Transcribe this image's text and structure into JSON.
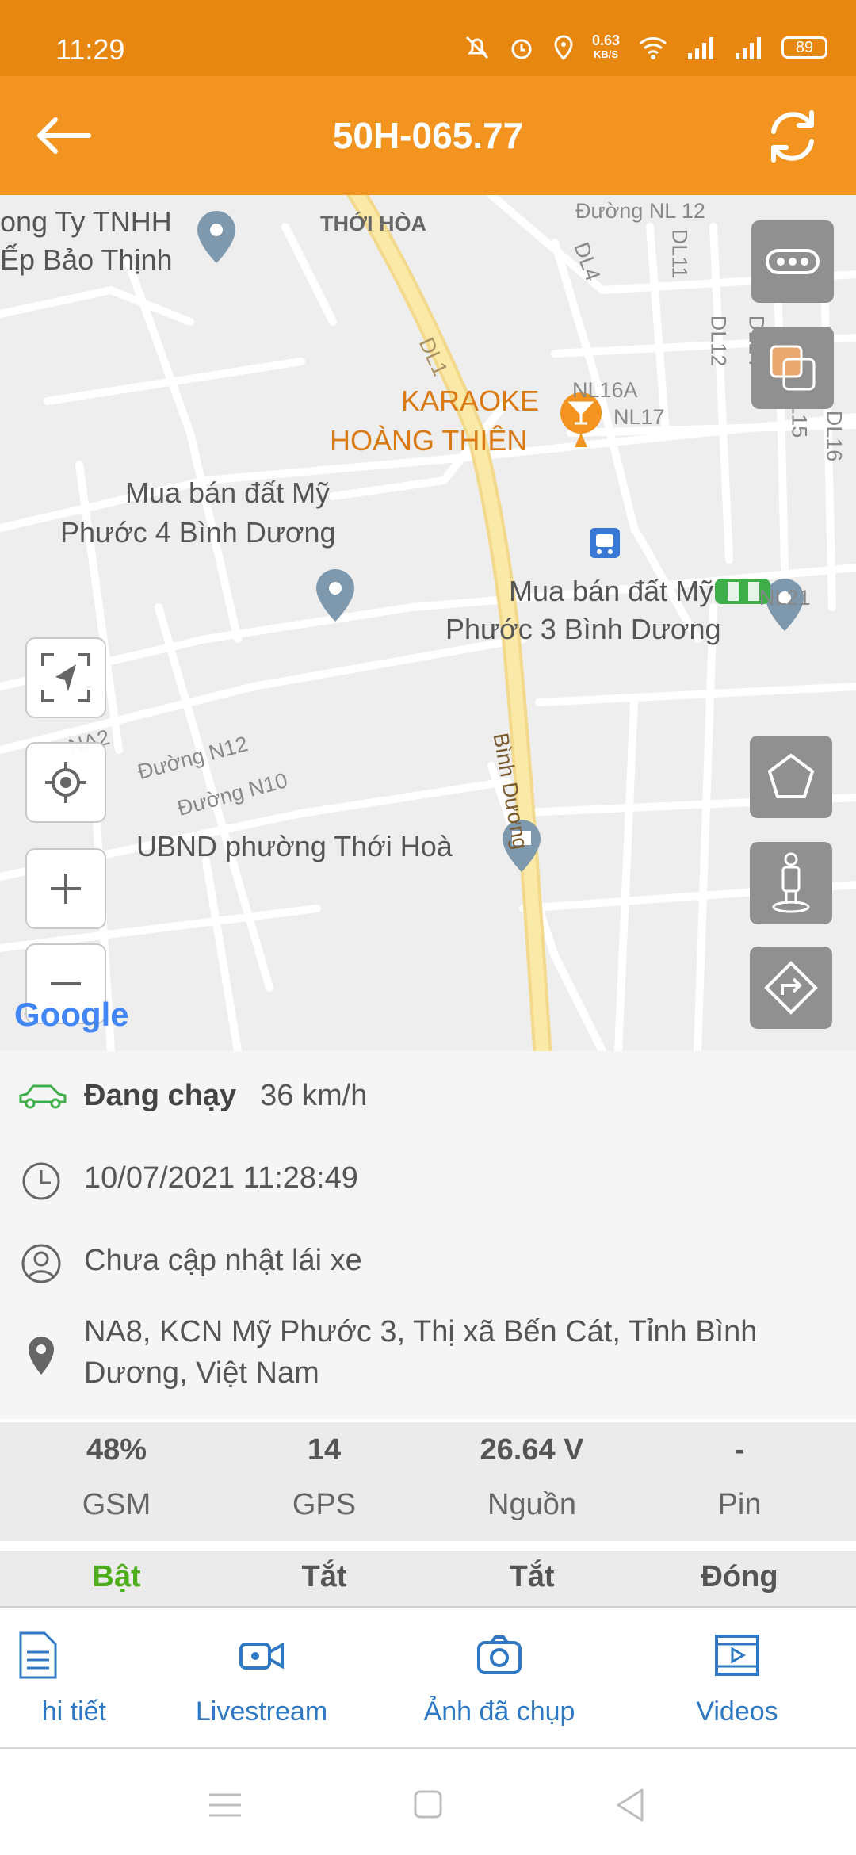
{
  "status_bar": {
    "time": "11:29",
    "net_speed": "0.63",
    "net_unit": "KB/S",
    "battery": "89"
  },
  "app_bar": {
    "title": "50H-065.77"
  },
  "map": {
    "labels": {
      "company_line1": "ong Ty TNHH",
      "company_line2": "Ếp Bảo Thịnh",
      "thoi_hoa": "THỚI HÒA",
      "nl12": "Đường NL 12",
      "dl4": "DL4",
      "dl11": "DL11",
      "dl12": "DL12",
      "dl14": "DL14",
      "dl15": "DL15",
      "dl16": "DL16",
      "nl16a": "NL16A",
      "nl17": "NL17",
      "nl21": "NL21",
      "dl_main": "DL1",
      "karaoke_line1": "KARAOKE",
      "karaoke_line2": "HOÀNG THIÊN",
      "mua4_line1": "Mua bán đất Mỹ",
      "mua4_line2": "Phước 4 Bình Dương",
      "mua3_line1": "Mua bán đất Mỹ",
      "mua3_line2": "Phước 3 Bình Dương",
      "na2": "NA2",
      "n12": "Đường N12",
      "n10": "Đường N10",
      "binh_duong": "Bình Dương",
      "ubnd": "UBND phường Thới Hoà",
      "google": "Google"
    }
  },
  "info": {
    "status": "Đang chạy",
    "speed": "36 km/h",
    "datetime": "10/07/2021 11:28:49",
    "driver": "Chưa cập nhật lái xe",
    "address": "NA8, KCN Mỹ Phước 3, Thị xã Bến Cát, Tỉnh Bình Dương, Việt Nam"
  },
  "stats": [
    {
      "value": "48%",
      "label": "GSM"
    },
    {
      "value": "14",
      "label": "GPS"
    },
    {
      "value": "26.64 V",
      "label": "Nguồn"
    },
    {
      "value": "-",
      "label": "Pin"
    }
  ],
  "states": [
    "Bật",
    "Tắt",
    "Tắt",
    "Đóng"
  ],
  "tabs": [
    {
      "label": "hi tiết",
      "icon": "document-icon"
    },
    {
      "label": "Livestream",
      "icon": "video-camera-icon"
    },
    {
      "label": "Ảnh đã chụp",
      "icon": "camera-icon"
    },
    {
      "label": "Videos",
      "icon": "film-icon"
    }
  ],
  "colors": {
    "status_bar": "#E8870F",
    "app_bar": "#F39421",
    "accent_blue": "#2F78C4",
    "on_green": "#4CAE1A"
  }
}
